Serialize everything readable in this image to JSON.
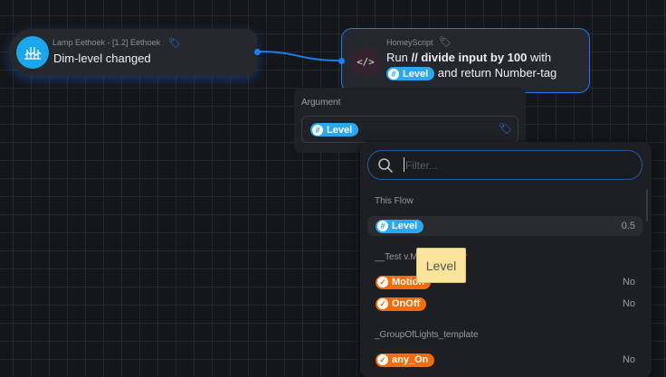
{
  "trigger": {
    "device": "Lamp Eethoek - [1.2] Eethoek",
    "title": "Dim-level changed",
    "icon": "lamp-icon"
  },
  "action": {
    "app": "HomeyScript",
    "run": "Run",
    "script": "// divide input by 100",
    "with": "with",
    "tag": "Level",
    "suffix": "and return Number-tag",
    "icon": "code-icon"
  },
  "argument": {
    "label": "Argument",
    "tag": "Level"
  },
  "dropdown": {
    "placeholder": "Filter...",
    "sections": [
      {
        "title": "This Flow",
        "items": [
          {
            "label": "Level",
            "type": "number",
            "value": "0.5"
          }
        ]
      },
      {
        "title": "__Test v.Motion sensor",
        "items": [
          {
            "label": "Motion",
            "type": "boolean",
            "value": "No"
          },
          {
            "label": "OnOff",
            "type": "boolean",
            "value": "No"
          }
        ]
      },
      {
        "title": "_GroupOfLights_template",
        "items": [
          {
            "label": "any_On",
            "type": "boolean",
            "value": "No"
          }
        ]
      }
    ]
  },
  "tooltip": "Level",
  "colors": {
    "accent": "#1a7df0",
    "number_tag": "#29a8f0",
    "boolean_tag": "#f36b0a"
  }
}
